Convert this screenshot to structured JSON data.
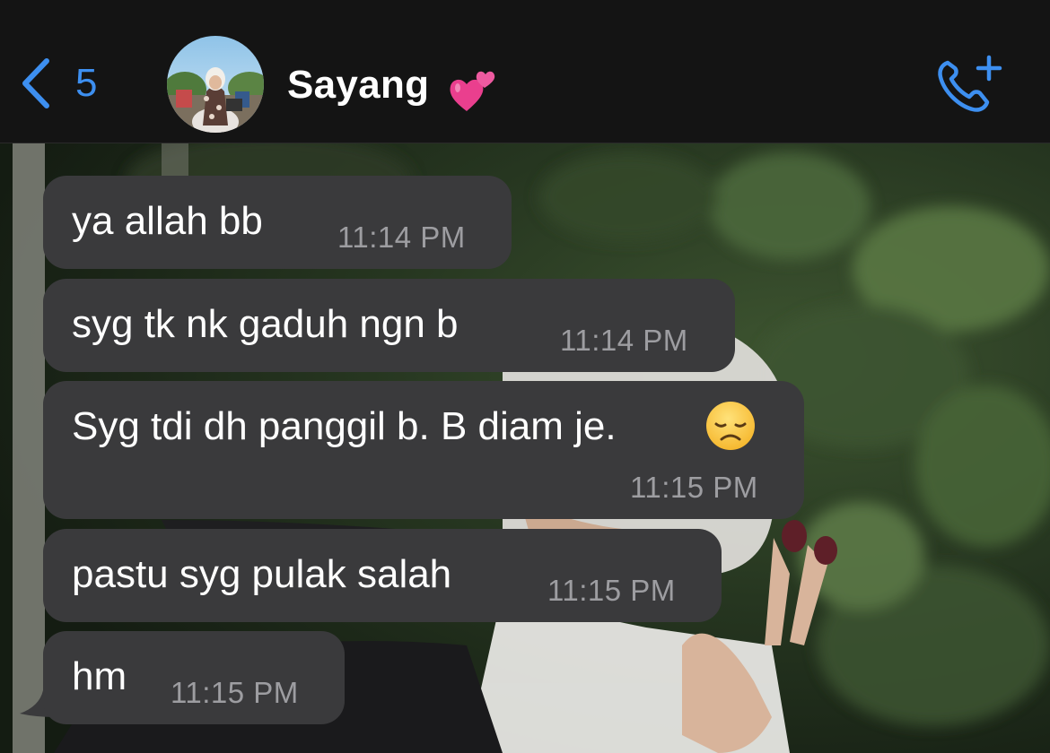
{
  "header": {
    "back_count": "5",
    "contact_name": "Sayang",
    "name_emoji": "two-hearts-emoji",
    "call_icon": "add-call-icon"
  },
  "colors": {
    "accent": "#3d8ff0",
    "header_bg": "#141414",
    "bubble_bg": "#3a3a3c",
    "timestamp": "#9d9da1"
  },
  "messages": [
    {
      "text": "ya allah  bb",
      "time": "11:14 PM"
    },
    {
      "text": "syg tk nk gaduh ngn b",
      "time": "11:14 PM"
    },
    {
      "text": "Syg tdi dh panggil b. B diam je.",
      "emoji": "disappointed-face-emoji",
      "time": "11:15 PM"
    },
    {
      "text": "pastu syg pulak salah",
      "time": "11:15 PM"
    },
    {
      "text": "hm",
      "time": "11:15 PM"
    }
  ]
}
